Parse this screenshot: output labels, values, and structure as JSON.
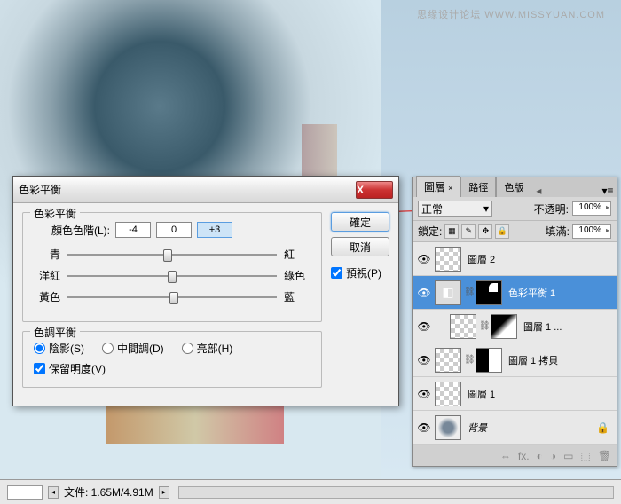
{
  "watermark": "思缘设计论坛  WWW.MISSYUAN.COM",
  "statusBar": {
    "zoom": "",
    "fileInfo": "文件: 1.65M/4.91M"
  },
  "dialog": {
    "title": "色彩平衡",
    "ok": "確定",
    "cancel": "取消",
    "preview": "預視(P)",
    "group1": {
      "legend": "色彩平衡",
      "levelsLabel": "顏色色階(L):",
      "v1": "-4",
      "v2": "0",
      "v3": "+3",
      "s1l": "青",
      "s1r": "紅",
      "s2l": "洋紅",
      "s2r": "綠色",
      "s3l": "黃色",
      "s3r": "藍"
    },
    "group2": {
      "legend": "色調平衡",
      "r1": "陰影(S)",
      "r2": "中間調(D)",
      "r3": "亮部(H)",
      "preserve": "保留明度(V)"
    }
  },
  "layersPanel": {
    "tabs": {
      "t1": "圖層",
      "t2": "路徑",
      "t3": "色版"
    },
    "blend": {
      "mode": "正常",
      "opacityLabel": "不透明:",
      "opacity": "100%",
      "lockLabel": "鎖定:",
      "fillLabel": "填滿:",
      "fill": "100%"
    },
    "layers": [
      {
        "name": "圖層 2"
      },
      {
        "name": "色彩平衡 1"
      },
      {
        "name": "圖層 1 ..."
      },
      {
        "name": "圖層 1 拷貝"
      },
      {
        "name": "圖層 1"
      },
      {
        "name": "背景"
      }
    ],
    "footer": {
      "link": "⇔",
      "fx": "fx.",
      "mask": "◐",
      "adj": "◑",
      "folder": "▭",
      "new": "⬚",
      "trash": "🗑"
    }
  }
}
